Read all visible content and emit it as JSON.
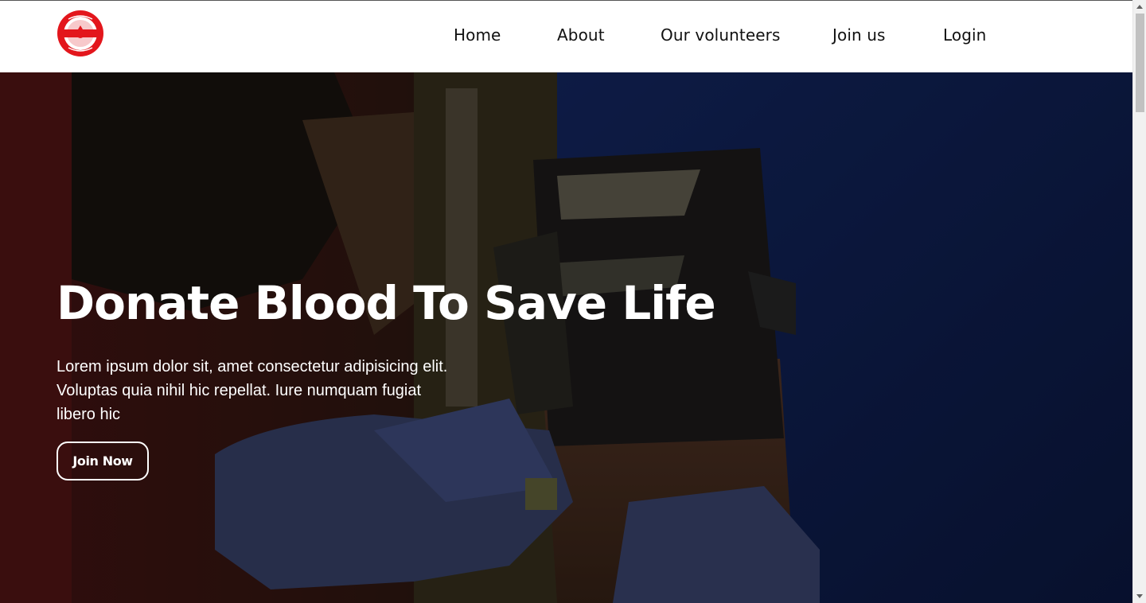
{
  "nav": {
    "links": [
      "Home",
      "About",
      "Our volunteers",
      "Join us",
      "Login"
    ]
  },
  "logo": {
    "icon": "blood-drop-badge-icon",
    "color": "#e3161c"
  },
  "hero": {
    "title": "Donate Blood To Save Life",
    "text_lines": [
      "Lorem ipsum dolor sit, amet consectetur adipisicing elit.",
      "Voluptas quia nihil hic repellat. Iure numquam fugiat",
      "libero hic"
    ],
    "button_label": "Join Now"
  },
  "colors": {
    "brand_red": "#e3161c",
    "hero_overlay": "#0d1430",
    "text_light": "#ffffff"
  }
}
